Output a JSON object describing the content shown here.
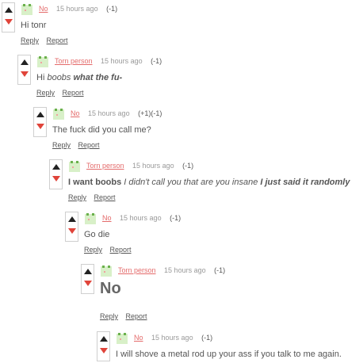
{
  "comments": [
    {
      "author": "No",
      "time": "15 hours ago",
      "score": "(-1)",
      "body": {
        "text": "Hi tonr"
      },
      "reply": "Reply",
      "report": "Report"
    },
    {
      "author": "Torn person",
      "time": "15 hours ago",
      "score": "(-1)",
      "body": {
        "a": "Hi ",
        "b": "boobs",
        "c": " ",
        "d": "what the fu-"
      },
      "reply": "Reply",
      "report": "Report"
    },
    {
      "author": "No",
      "time": "15 hours ago",
      "score": "(+1)(-1)",
      "body": {
        "text": "The fuck did you call me?"
      },
      "reply": "Reply",
      "report": "Report"
    },
    {
      "author": "Torn person",
      "time": "15 hours ago",
      "score": "(-1)",
      "body": {
        "a": "I want boobs",
        "b": " I didn't call you that are you insane ",
        "c": "I just said it randomly"
      },
      "reply": "Reply",
      "report": "Report"
    },
    {
      "author": "No",
      "time": "15 hours ago",
      "score": "(-1)",
      "body": {
        "text": "Go die"
      },
      "reply": "Reply",
      "report": "Report"
    },
    {
      "author": "Torn person",
      "time": "15 hours ago",
      "score": "(-1)",
      "body": {
        "text": "No"
      },
      "reply": "Reply",
      "report": "Report"
    },
    {
      "author": "No",
      "time": "15 hours ago",
      "score": "(-1)",
      "body": {
        "text": "I will shove a metal rod up your ass if you talk to me again."
      },
      "reply": "Reply",
      "report": "Report"
    }
  ],
  "colors": {
    "author_link": "#e46b6b",
    "downvote_arrow": "#e0443a",
    "upvote_arrow": "#222222",
    "avatar_background": "#d8f0c8"
  }
}
